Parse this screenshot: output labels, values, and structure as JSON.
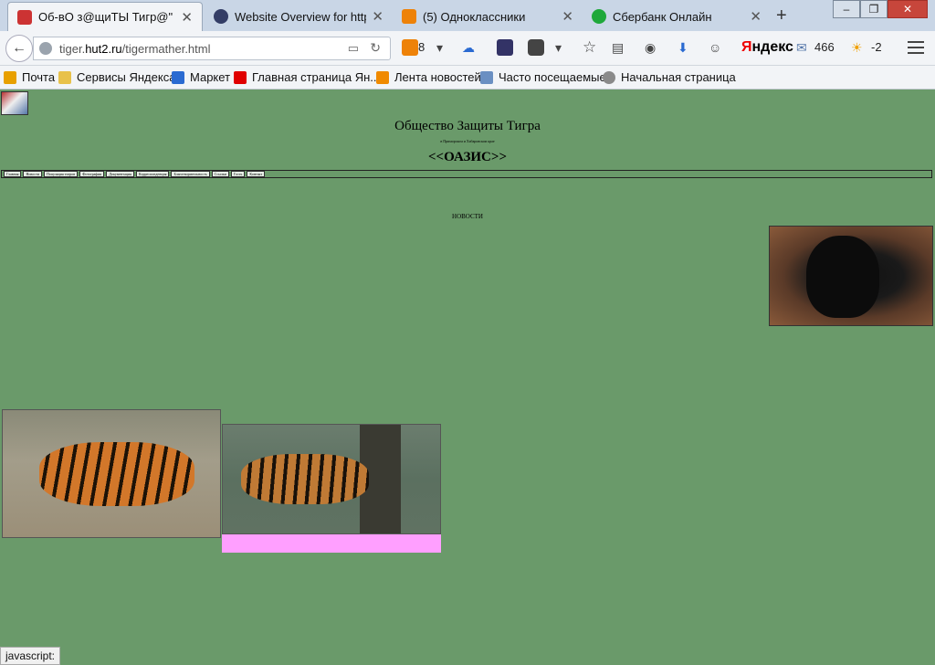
{
  "browser": {
    "tabs": [
      {
        "title": "Об-вО з@щиТЫ Тигр@\"",
        "active": true,
        "favicon_color": "#cc3333"
      },
      {
        "title": "Website Overview for http:...",
        "active": false,
        "favicon_color": "#333d66"
      },
      {
        "title": "(5) Одноклассники",
        "active": false,
        "favicon_color": "#ee8208"
      },
      {
        "title": "Сбербанк Онлайн",
        "active": false,
        "favicon_color": "#1fa83a"
      }
    ],
    "url_host_prefix": "tiger.",
    "url_host_main": "hut2.ru",
    "url_path": "/tigermather.html",
    "ok_count": "8",
    "yandex_label": "Яндекс",
    "mail_count": "466",
    "weather": "-2",
    "bookmarks": [
      {
        "label": "Почта",
        "icon": "mail-icon",
        "color": "#e8a000"
      },
      {
        "label": "Сервисы Яндекса",
        "icon": "folder-icon",
        "color": "#e8c14a"
      },
      {
        "label": "Маркет",
        "icon": "cart-icon",
        "color": "#2a6ad1"
      },
      {
        "label": "Главная страница Ян...",
        "icon": "yandex-icon",
        "color": "#e00000"
      },
      {
        "label": "Лента новостей",
        "icon": "rss-icon",
        "color": "#f08a00"
      },
      {
        "label": "Часто посещаемые",
        "icon": "folder-icon",
        "color": "#6a8fc2"
      },
      {
        "label": "Начальная страница",
        "icon": "globe-icon",
        "color": "#8a8a8a"
      }
    ],
    "status_text": "javascript:"
  },
  "site": {
    "title": "Общество Защиты Тигра",
    "subtitle": "в Приморском и Хабаровском крае",
    "oasis": "<<ОАЗИС>>",
    "menu": [
      "Главная",
      "Новости",
      "Популяция тигров",
      "Фотографии",
      "Документация",
      "Корреспонденция",
      "Благотворительность",
      "Ссылки",
      "Гость",
      "Контакт"
    ],
    "news_heading": "НОВОСТИ"
  }
}
